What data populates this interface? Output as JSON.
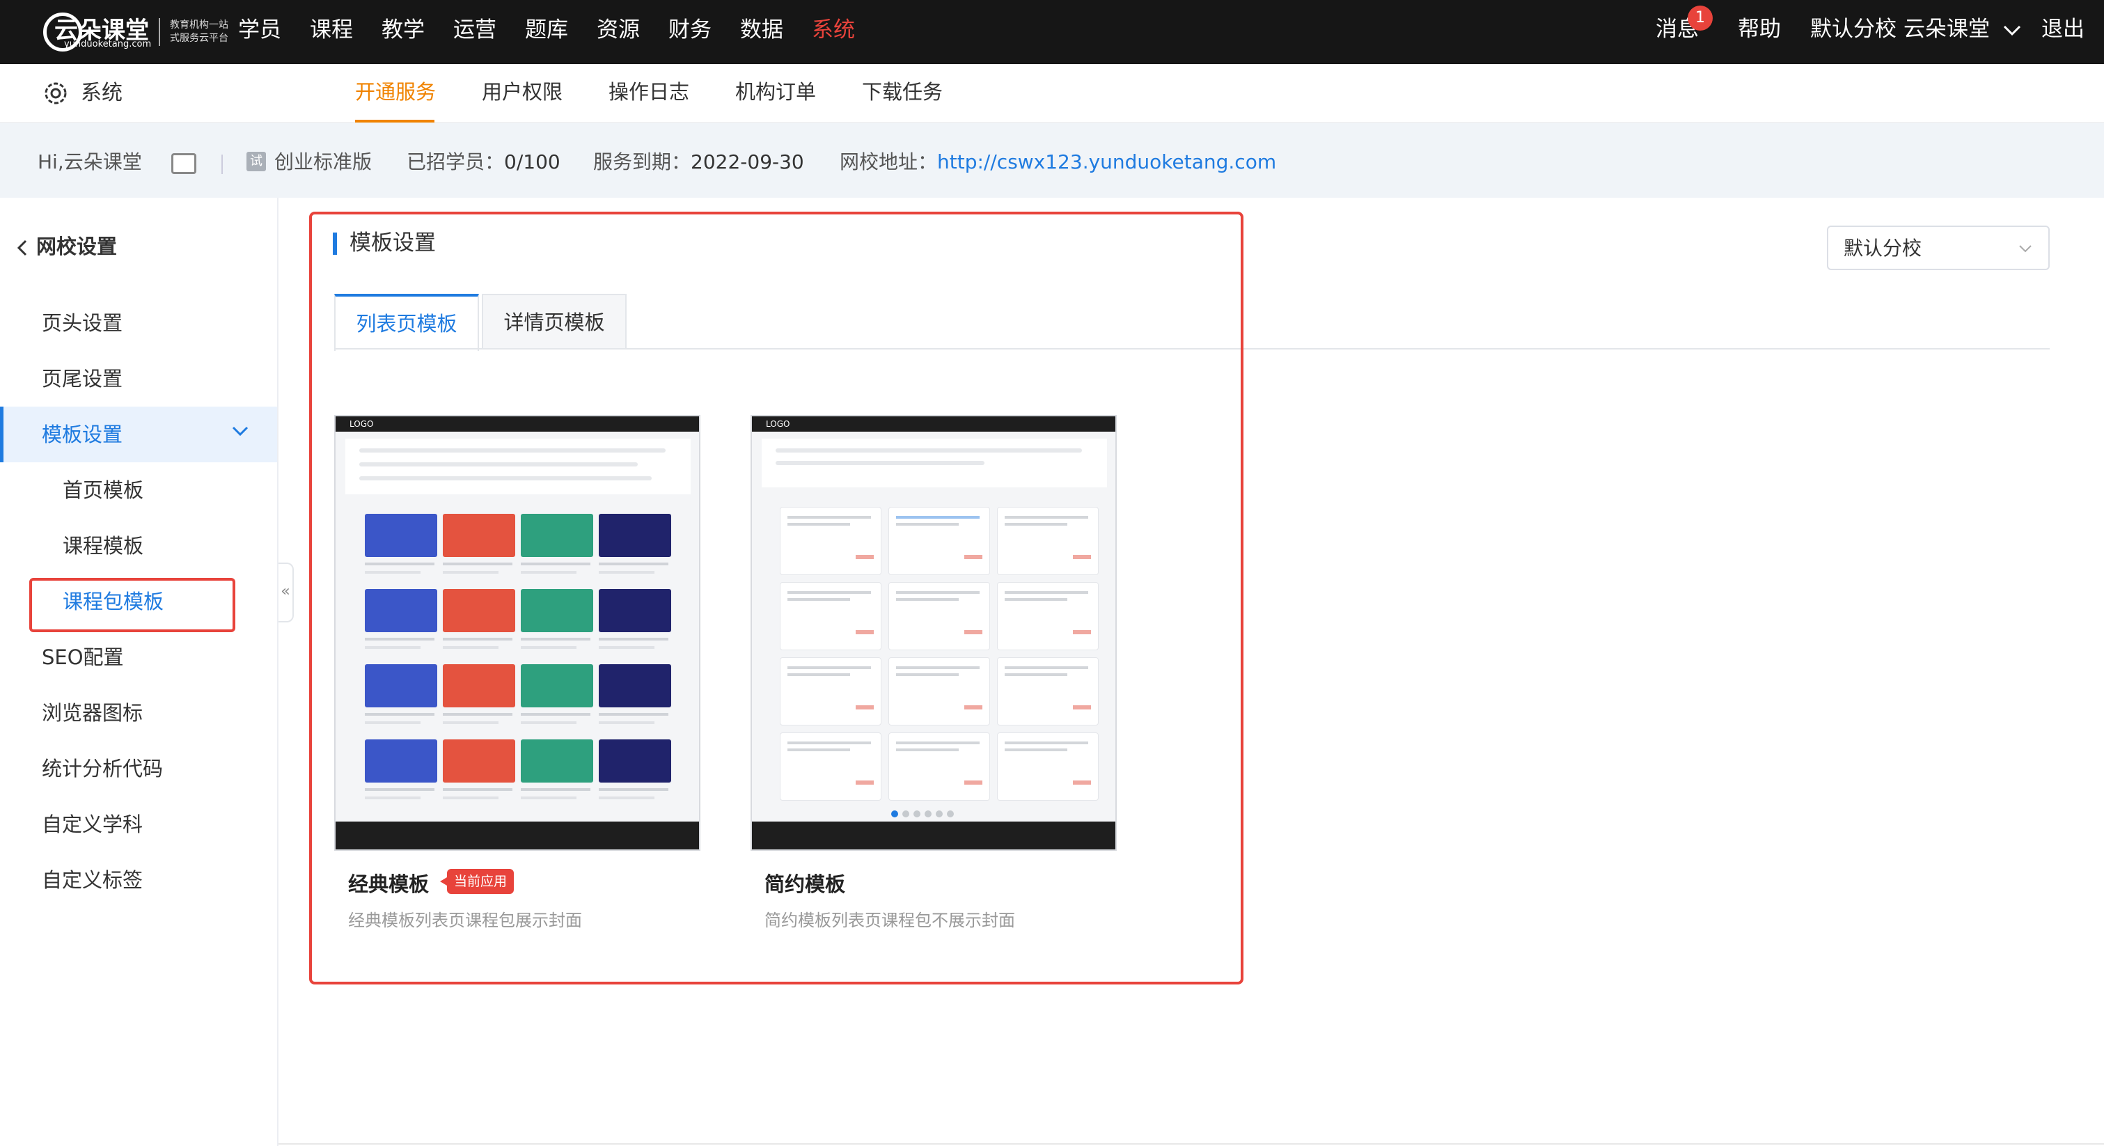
{
  "topnav": {
    "logo_text": "云朵课堂",
    "logo_sub": "yunduoketang.com",
    "logo_tagline": "教育机构一站式服务云平台",
    "menu": [
      "学员",
      "课程",
      "教学",
      "运营",
      "题库",
      "资源",
      "财务",
      "数据",
      "系统"
    ],
    "active_menu": "系统",
    "messages_label": "消息",
    "messages_count": "1",
    "help_label": "帮助",
    "branch_label": "默认分校",
    "account_label": "云朵课堂",
    "logout_label": "退出"
  },
  "subnav": {
    "section_label": "系统",
    "tabs": [
      "开通服务",
      "用户权限",
      "操作日志",
      "机构订单",
      "下载任务"
    ],
    "active_tab": "开通服务"
  },
  "infobar": {
    "greeting": "Hi,云朵课堂",
    "trial_icon": "试",
    "edition": "创业标准版",
    "students_label": "已招学员：",
    "students_value": "0/100",
    "expiry_label": "服务到期：",
    "expiry_value": "2022-09-30",
    "url_label": "网校地址：",
    "url_value": "http://cswx123.yunduoketang.com"
  },
  "sidebar": {
    "back_label": "网校设置",
    "items": [
      {
        "label": "页头设置"
      },
      {
        "label": "页尾设置"
      },
      {
        "label": "模板设置"
      },
      {
        "label": "首页模板"
      },
      {
        "label": "课程模板"
      },
      {
        "label": "课程包模板"
      },
      {
        "label": "SEO配置"
      },
      {
        "label": "浏览器图标"
      },
      {
        "label": "统计分析代码"
      },
      {
        "label": "自定义学科"
      },
      {
        "label": "自定义标签"
      }
    ],
    "collapse_glyph": "«"
  },
  "main": {
    "section_title": "模板设置",
    "branch_select": "默认分校",
    "tabs": [
      "列表页模板",
      "详情页模板"
    ],
    "active_tab": "列表页模板",
    "templates": [
      {
        "name": "经典模板",
        "tag": "当前应用",
        "desc": "经典模板列表页课程包展示封面",
        "preview_logo": "LOGO"
      },
      {
        "name": "简约模板",
        "desc": "简约模板列表页课程包不展示封面",
        "preview_logo": "LOGO"
      }
    ]
  },
  "colors": {
    "accent_blue": "#1f7be0",
    "accent_orange": "#f08300",
    "alert_red": "#e8433b",
    "topbar": "#161616"
  }
}
